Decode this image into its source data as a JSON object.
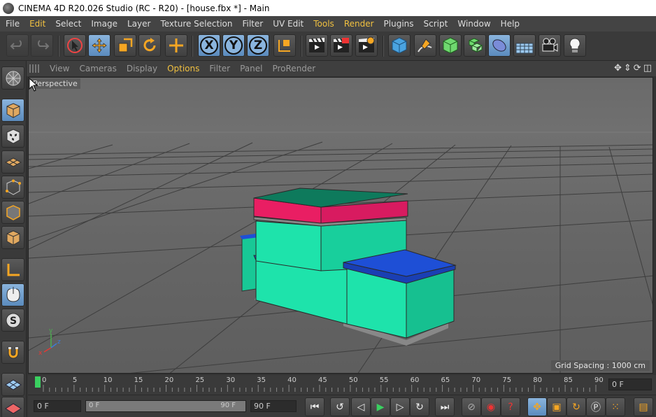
{
  "window": {
    "title": "CINEMA 4D R20.026 Studio (RC - R20) - [house.fbx *] - Main"
  },
  "menubar": [
    {
      "label": "File"
    },
    {
      "label": "Edit",
      "highlight": true
    },
    {
      "label": "Select"
    },
    {
      "label": "Image"
    },
    {
      "label": "Layer"
    },
    {
      "label": "Texture Selection"
    },
    {
      "label": "Filter"
    },
    {
      "label": "UV Edit"
    },
    {
      "label": "Tools",
      "highlight": true
    },
    {
      "label": "Render",
      "highlight": true
    },
    {
      "label": "Plugins"
    },
    {
      "label": "Script"
    },
    {
      "label": "Window"
    },
    {
      "label": "Help"
    }
  ],
  "toolbar": {
    "axis_x": "X",
    "axis_y": "Y",
    "axis_z": "Z",
    "icons": [
      "undo-icon",
      "redo-icon",
      "select-arrow-icon",
      "move-icon",
      "scale-icon",
      "rotate-icon",
      "add-icon",
      "x-axis-icon",
      "y-axis-icon",
      "z-axis-icon",
      "coordinate-system-icon",
      "render-view-icon",
      "render-picture-viewer-icon",
      "edit-render-settings-icon",
      "cube-icon",
      "pen-icon",
      "subdivision-icon",
      "array-icon",
      "deformer-icon",
      "floor-icon",
      "camera-icon",
      "light-icon"
    ]
  },
  "viewport_menu": [
    {
      "label": "View"
    },
    {
      "label": "Cameras"
    },
    {
      "label": "Display"
    },
    {
      "label": "Options",
      "highlight": true
    },
    {
      "label": "Filter"
    },
    {
      "label": "Panel"
    },
    {
      "label": "ProRender"
    }
  ],
  "viewport": {
    "label": "Perspective",
    "grid_spacing": "Grid Spacing : 1000 cm",
    "axis_gizmo": {
      "y": "y",
      "x": "x",
      "z": "z"
    },
    "colors": {
      "teal": "#1ee3ab",
      "pink": "#e91e63",
      "blue": "#1e4fd6",
      "dark_teal": "#0e7a5c"
    }
  },
  "timeline": {
    "ticks": [
      "0",
      "5",
      "10",
      "15",
      "20",
      "25",
      "30",
      "35",
      "40",
      "45",
      "50",
      "55",
      "60",
      "65",
      "70",
      "75",
      "80",
      "85",
      "90"
    ],
    "current_frame": "0 F"
  },
  "bottom": {
    "start_field": "0 F",
    "slider_left": "0 F",
    "slider_right": "90 F",
    "end_field": "90 F"
  }
}
